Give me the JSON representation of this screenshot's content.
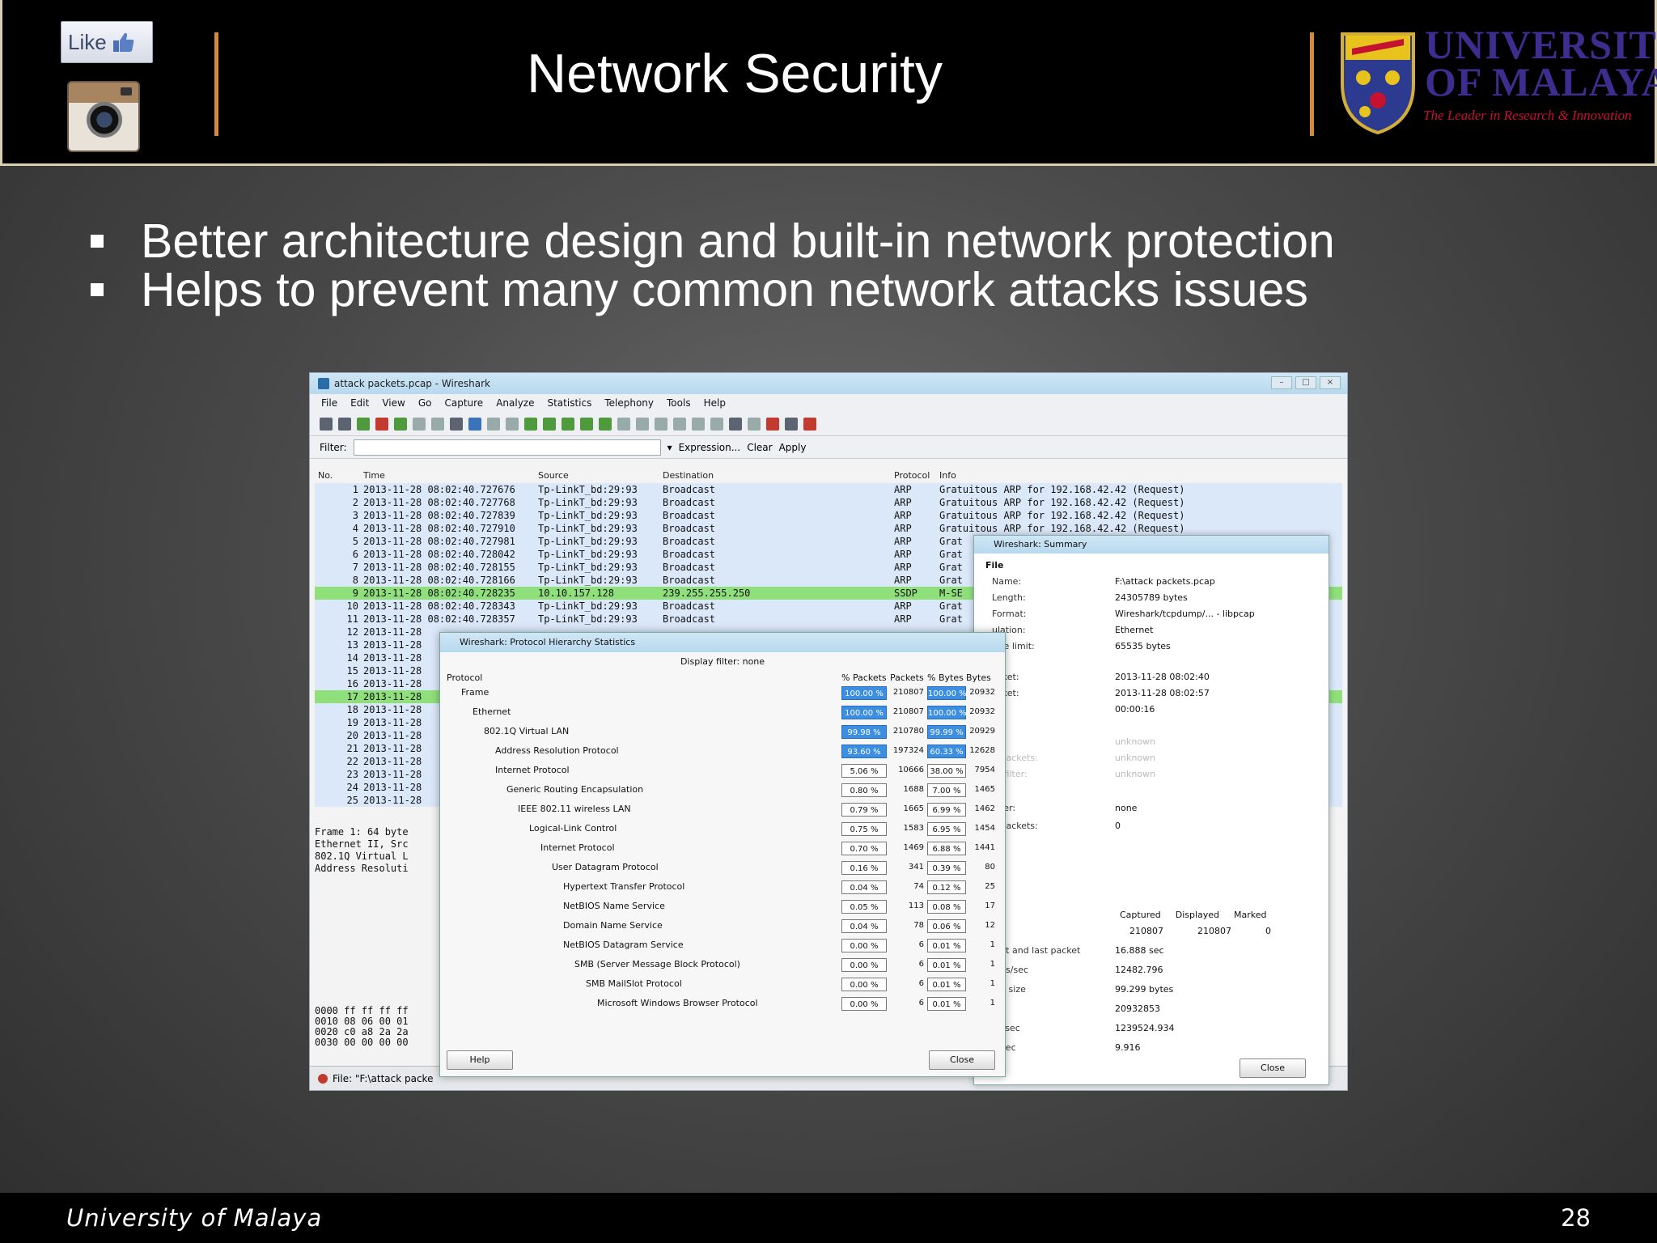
{
  "header": {
    "like_label": "Like",
    "title": "Network Security",
    "university_line1": "UNIVERSITY",
    "university_line2": "OF MALAYA",
    "tagline": "The Leader in Research & Innovation"
  },
  "bullets": [
    "Better architecture design and built-in network protection",
    "Helps to prevent many common network attacks issues"
  ],
  "wireshark": {
    "window_title": "attack packets.pcap - Wireshark",
    "menu": [
      "File",
      "Edit",
      "View",
      "Go",
      "Capture",
      "Analyze",
      "Statistics",
      "Telephony",
      "Tools",
      "Help"
    ],
    "filter_label": "Filter:",
    "filter_buttons": [
      "Expression...",
      "Clear",
      "Apply"
    ],
    "columns": [
      "No.",
      "Time",
      "Source",
      "Destination",
      "Protocol",
      "Info"
    ],
    "packets": [
      {
        "no": "1",
        "time": "2013-11-28 08:02:40.727676",
        "src": "Tp-LinkT_bd:29:93",
        "dst": "Broadcast",
        "proto": "ARP",
        "info": "Gratuitous ARP for 192.168.42.42 (Request)"
      },
      {
        "no": "2",
        "time": "2013-11-28 08:02:40.727768",
        "src": "Tp-LinkT_bd:29:93",
        "dst": "Broadcast",
        "proto": "ARP",
        "info": "Gratuitous ARP for 192.168.42.42 (Request)"
      },
      {
        "no": "3",
        "time": "2013-11-28 08:02:40.727839",
        "src": "Tp-LinkT_bd:29:93",
        "dst": "Broadcast",
        "proto": "ARP",
        "info": "Gratuitous ARP for 192.168.42.42 (Request)"
      },
      {
        "no": "4",
        "time": "2013-11-28 08:02:40.727910",
        "src": "Tp-LinkT_bd:29:93",
        "dst": "Broadcast",
        "proto": "ARP",
        "info": "Gratuitous ARP for 192.168.42.42 (Request)"
      },
      {
        "no": "5",
        "time": "2013-11-28 08:02:40.727981",
        "src": "Tp-LinkT_bd:29:93",
        "dst": "Broadcast",
        "proto": "ARP",
        "info": "Grat"
      },
      {
        "no": "6",
        "time": "2013-11-28 08:02:40.728042",
        "src": "Tp-LinkT_bd:29:93",
        "dst": "Broadcast",
        "proto": "ARP",
        "info": "Grat"
      },
      {
        "no": "7",
        "time": "2013-11-28 08:02:40.728155",
        "src": "Tp-LinkT_bd:29:93",
        "dst": "Broadcast",
        "proto": "ARP",
        "info": "Grat"
      },
      {
        "no": "8",
        "time": "2013-11-28 08:02:40.728166",
        "src": "Tp-LinkT_bd:29:93",
        "dst": "Broadcast",
        "proto": "ARP",
        "info": "Grat"
      },
      {
        "no": "9",
        "time": "2013-11-28 08:02:40.728235",
        "src": "10.10.157.128",
        "dst": "239.255.255.250",
        "proto": "SSDP",
        "info": "M-SE",
        "hl": true
      },
      {
        "no": "10",
        "time": "2013-11-28 08:02:40.728343",
        "src": "Tp-LinkT_bd:29:93",
        "dst": "Broadcast",
        "proto": "ARP",
        "info": "Grat"
      },
      {
        "no": "11",
        "time": "2013-11-28 08:02:40.728357",
        "src": "Tp-LinkT_bd:29:93",
        "dst": "Broadcast",
        "proto": "ARP",
        "info": "Grat"
      },
      {
        "no": "12",
        "time": "2013-11-28",
        "src": "",
        "dst": "",
        "proto": "",
        "info": ""
      },
      {
        "no": "13",
        "time": "2013-11-28",
        "src": "",
        "dst": "",
        "proto": "",
        "info": ""
      },
      {
        "no": "14",
        "time": "2013-11-28",
        "src": "",
        "dst": "",
        "proto": "",
        "info": ""
      },
      {
        "no": "15",
        "time": "2013-11-28",
        "src": "",
        "dst": "",
        "proto": "",
        "info": ""
      },
      {
        "no": "16",
        "time": "2013-11-28",
        "src": "",
        "dst": "",
        "proto": "",
        "info": ""
      },
      {
        "no": "17",
        "time": "2013-11-28",
        "src": "",
        "dst": "",
        "proto": "",
        "info": "",
        "hl": true
      },
      {
        "no": "18",
        "time": "2013-11-28",
        "src": "",
        "dst": "",
        "proto": "",
        "info": ""
      },
      {
        "no": "19",
        "time": "2013-11-28",
        "src": "",
        "dst": "",
        "proto": "",
        "info": ""
      },
      {
        "no": "20",
        "time": "2013-11-28",
        "src": "",
        "dst": "",
        "proto": "",
        "info": ""
      },
      {
        "no": "21",
        "time": "2013-11-28",
        "src": "",
        "dst": "",
        "proto": "",
        "info": ""
      },
      {
        "no": "22",
        "time": "2013-11-28",
        "src": "",
        "dst": "",
        "proto": "",
        "info": ""
      },
      {
        "no": "23",
        "time": "2013-11-28",
        "src": "",
        "dst": "",
        "proto": "",
        "info": ""
      },
      {
        "no": "24",
        "time": "2013-11-28",
        "src": "",
        "dst": "",
        "proto": "",
        "info": ""
      },
      {
        "no": "25",
        "time": "2013-11-28",
        "src": "",
        "dst": "",
        "proto": "",
        "info": ""
      }
    ],
    "detail_lines": [
      "Frame 1: 64 byte",
      "Ethernet II, Src",
      "802.1Q Virtual L",
      "Address Resoluti"
    ],
    "hex_lines": [
      "0000  ff ff ff ff",
      "0010  08 06 00 01",
      "0020  c0 a8 2a 2a",
      "0030  00 00 00 00"
    ],
    "status": "File: \"F:\\attack packe"
  },
  "summary": {
    "title": "Wireshark: Summary",
    "section_file": "File",
    "rows": [
      {
        "k": "Name:",
        "v": "F:\\attack packets.pcap"
      },
      {
        "k": "Length:",
        "v": "24305789 bytes"
      },
      {
        "k": "Format:",
        "v": "Wireshark/tcpdump/... - libpcap"
      },
      {
        "k": "ulation:",
        "v": "Ethernet"
      },
      {
        "k": "size limit:",
        "v": "65535 bytes"
      },
      {
        "k": "acket:",
        "v": "2013-11-28 08:02:40"
      },
      {
        "k": "acket:",
        "v": "2013-11-28 08:02:57"
      },
      {
        "k": "l:",
        "v": "00:00:16"
      },
      {
        "k": "ce:",
        "v": "unknown",
        "gray": true
      },
      {
        "k": "d packets:",
        "v": "unknown",
        "gray": true
      },
      {
        "k": "re filter:",
        "v": "unknown",
        "gray": true
      },
      {
        "k": "filter:",
        "v": "none"
      },
      {
        "k": "d packets:",
        "v": "0"
      }
    ],
    "cols": [
      "Captured",
      "Displayed",
      "Marked"
    ],
    "counts": [
      "210807",
      "210807",
      "0"
    ],
    "stats": [
      {
        "k": "first and last packet",
        "v": "16.888 sec"
      },
      {
        "k": "kets/sec",
        "v": "12482.796"
      },
      {
        "k": "ket size",
        "v": "99.299 bytes"
      },
      {
        "k": "",
        "v": "20932853"
      },
      {
        "k": "es/sec",
        "v": "1239524.934"
      },
      {
        "k": "it/sec",
        "v": "9.916"
      }
    ],
    "close": "Close"
  },
  "hierarchy": {
    "title": "Wireshark: Protocol Hierarchy Statistics",
    "display_filter": "Display filter: none",
    "columns": [
      "Protocol",
      "% Packets",
      "Packets",
      "% Bytes",
      "Bytes"
    ],
    "rows": [
      {
        "name": "Frame",
        "indent": 0,
        "pp": "100.00 %",
        "pk": "210807",
        "pb": "100.00 %",
        "by": "20932",
        "fill": 1.0
      },
      {
        "name": "Ethernet",
        "indent": 1,
        "pp": "100.00 %",
        "pk": "210807",
        "pb": "100.00 %",
        "by": "20932",
        "fill": 1.0
      },
      {
        "name": "802.1Q Virtual LAN",
        "indent": 2,
        "pp": "99.98 %",
        "pk": "210780",
        "pb": "99.99 %",
        "by": "20929",
        "fill": 1.0
      },
      {
        "name": "Address Resolution Protocol",
        "indent": 3,
        "pp": "93.60 %",
        "pk": "197324",
        "pb": "60.33 %",
        "by": "12628",
        "fill": 0.94
      },
      {
        "name": "Internet Protocol",
        "indent": 3,
        "pp": "5.06 %",
        "pk": "10666",
        "pb": "38.00 %",
        "by": "7954",
        "fill": 0.05
      },
      {
        "name": "Generic Routing Encapsulation",
        "indent": 4,
        "pp": "0.80 %",
        "pk": "1688",
        "pb": "7.00 %",
        "by": "1465",
        "fill": 0.01
      },
      {
        "name": "IEEE 802.11 wireless LAN",
        "indent": 5,
        "pp": "0.79 %",
        "pk": "1665",
        "pb": "6.99 %",
        "by": "1462",
        "fill": 0.01
      },
      {
        "name": "Logical-Link Control",
        "indent": 6,
        "pp": "0.75 %",
        "pk": "1583",
        "pb": "6.95 %",
        "by": "1454",
        "fill": 0.01
      },
      {
        "name": "Internet Protocol",
        "indent": 7,
        "pp": "0.70 %",
        "pk": "1469",
        "pb": "6.88 %",
        "by": "1441",
        "fill": 0.01
      },
      {
        "name": "User Datagram Protocol",
        "indent": 8,
        "pp": "0.16 %",
        "pk": "341",
        "pb": "0.39 %",
        "by": "80",
        "fill": 0.0
      },
      {
        "name": "Hypertext Transfer Protocol",
        "indent": 9,
        "pp": "0.04 %",
        "pk": "74",
        "pb": "0.12 %",
        "by": "25",
        "fill": 0.0
      },
      {
        "name": "NetBIOS Name Service",
        "indent": 9,
        "pp": "0.05 %",
        "pk": "113",
        "pb": "0.08 %",
        "by": "17",
        "fill": 0.0
      },
      {
        "name": "Domain Name Service",
        "indent": 9,
        "pp": "0.04 %",
        "pk": "78",
        "pb": "0.06 %",
        "by": "12",
        "fill": 0.0
      },
      {
        "name": "NetBIOS Datagram Service",
        "indent": 9,
        "pp": "0.00 %",
        "pk": "6",
        "pb": "0.01 %",
        "by": "1",
        "fill": 0.0
      },
      {
        "name": "SMB (Server Message Block Protocol)",
        "indent": 10,
        "pp": "0.00 %",
        "pk": "6",
        "pb": "0.01 %",
        "by": "1",
        "fill": 0.0
      },
      {
        "name": "SMB MailSlot Protocol",
        "indent": 11,
        "pp": "0.00 %",
        "pk": "6",
        "pb": "0.01 %",
        "by": "1",
        "fill": 0.0
      },
      {
        "name": "Microsoft Windows Browser Protocol",
        "indent": 12,
        "pp": "0.00 %",
        "pk": "6",
        "pb": "0.01 %",
        "by": "1",
        "fill": 0.0
      }
    ],
    "help": "Help",
    "close": "Close"
  },
  "footer": {
    "left": "University of Malaya",
    "page": "28"
  },
  "colors": {
    "header_bg": "#000000",
    "accent_divider": "#d58a3a",
    "uni_blue": "#3c2d8f",
    "uni_red": "#c41230",
    "highlight_green": "#8fe07a",
    "bar_blue": "#3b8ee0"
  }
}
